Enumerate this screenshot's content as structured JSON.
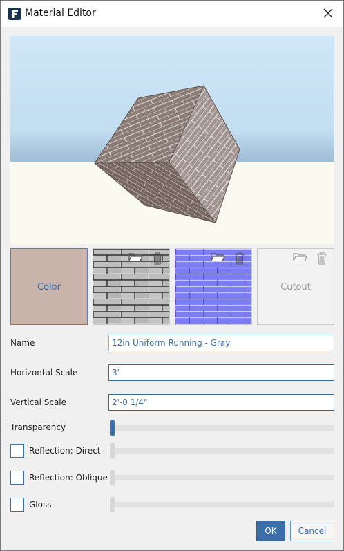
{
  "window": {
    "title": "Material Editor",
    "icon": "formit-f-icon"
  },
  "maps": {
    "color_label": "Color",
    "cutout_label": "Cutout"
  },
  "fields": {
    "name_label": "Name",
    "name_value": "12in Uniform Running - Gray",
    "horizontal_label": "Horizontal Scale",
    "horizontal_value": "3'",
    "vertical_label": "Vertical Scale",
    "vertical_value": "2'-0 1/4\""
  },
  "sliders": {
    "transparency_label": "Transparency",
    "transparency_value": 0,
    "reflection_direct_label": "Reflection: Direct",
    "reflection_direct_checked": false,
    "reflection_oblique_label": "Reflection: Oblique",
    "reflection_oblique_checked": false,
    "gloss_label": "Gloss",
    "gloss_checked": false
  },
  "buttons": {
    "ok": "OK",
    "cancel": "Cancel"
  },
  "colors": {
    "accent": "#3d6ea8",
    "color_swatch": "#c9b4ab",
    "sky": "#cfe6f6",
    "ground": "#fbfaf1"
  }
}
